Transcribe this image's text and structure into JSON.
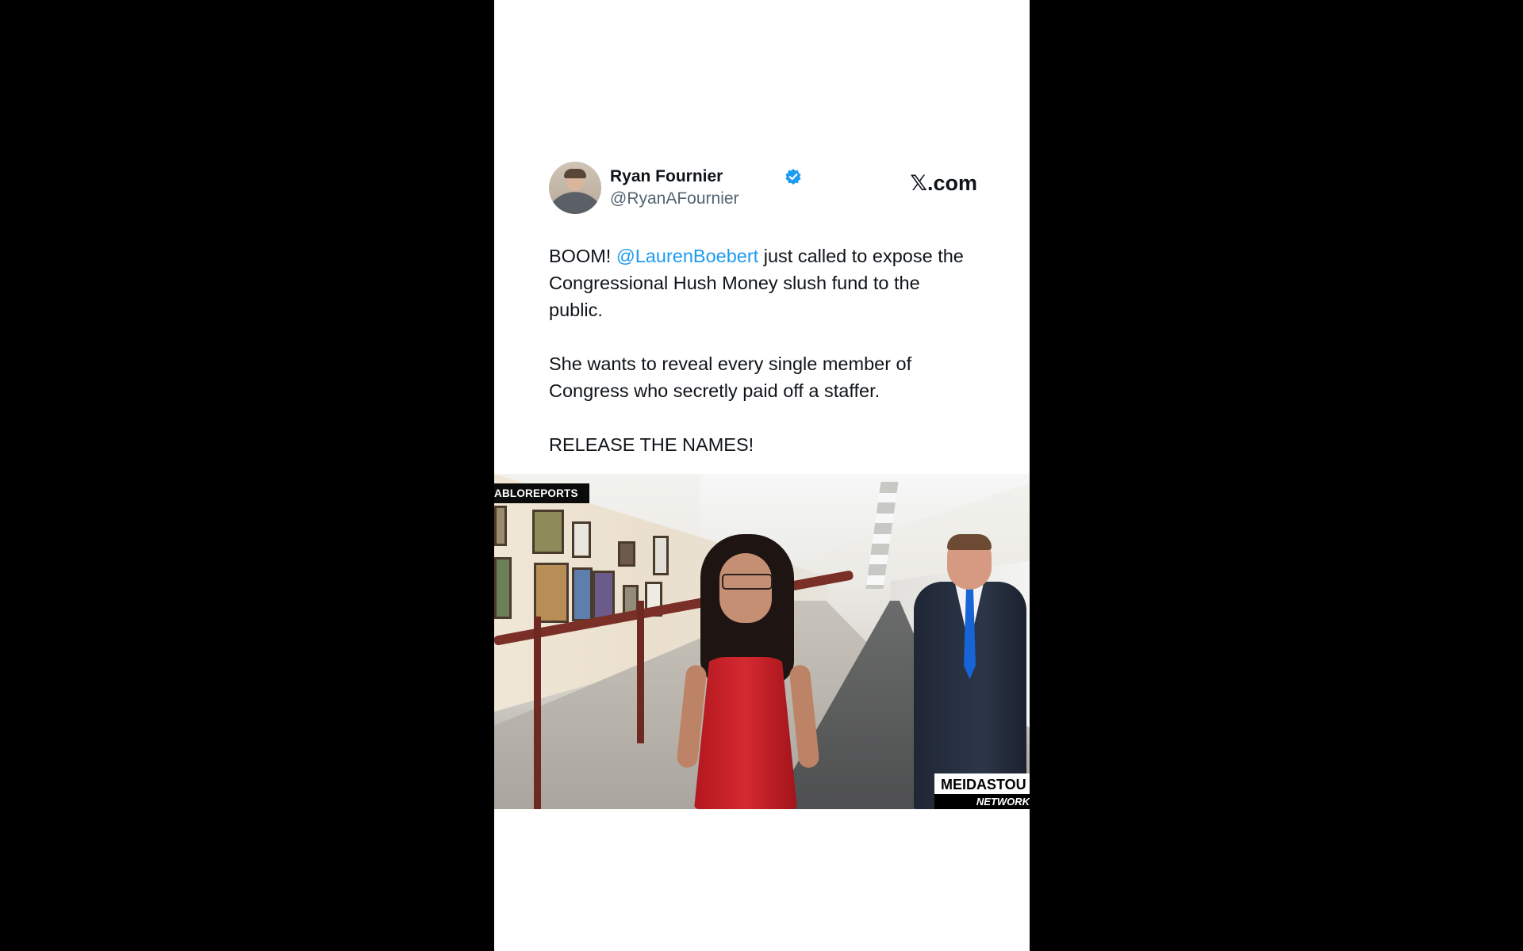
{
  "tweet": {
    "display_name": "Ryan Fournier",
    "handle": "@RyanAFournier",
    "brand_x": "𝕏",
    "brand_domain": ".com",
    "paragraph1_before": "BOOM! ",
    "mention": "@LaurenBoebert",
    "paragraph1_after": " just called to expose the Congressional Hush Money slush fund to the public.",
    "paragraph2": "She wants to reveal every single member of Congress who secretly paid off a staffer.",
    "paragraph3": "RELEASE THE NAMES!"
  },
  "video": {
    "watermark_top": "ABLOREPORTS",
    "watermark_bottom_main": "MEIDASTOU",
    "watermark_bottom_sub": "NETWORK"
  },
  "colors": {
    "mention": "#1d9bf0",
    "verified": "#1d9bf0",
    "background": "#000000",
    "card": "#ffffff"
  },
  "icons": {
    "verified": "verified-badge-icon",
    "avatar": "profile-avatar"
  }
}
